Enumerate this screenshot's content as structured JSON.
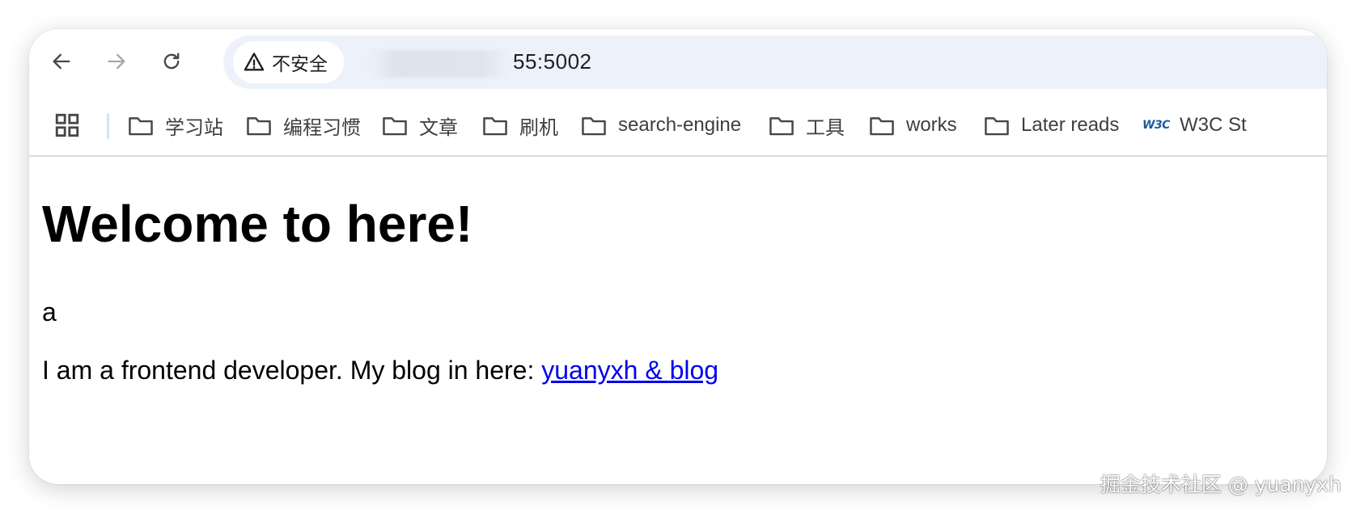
{
  "browser": {
    "nav": {
      "back_icon": "arrow-left-icon",
      "forward_icon": "arrow-right-icon",
      "reload_icon": "reload-icon"
    },
    "omnibox": {
      "security_icon": "warning-triangle-icon",
      "security_label": "不安全",
      "url_visible": "55:5002"
    },
    "bookmarks": [
      {
        "label": "学习站",
        "icon": "folder-icon"
      },
      {
        "label": "编程习惯",
        "icon": "folder-icon"
      },
      {
        "label": "文章",
        "icon": "folder-icon"
      },
      {
        "label": "刷机",
        "icon": "folder-icon"
      },
      {
        "label": "search-engine",
        "icon": "folder-icon"
      },
      {
        "label": "工具",
        "icon": "folder-icon"
      },
      {
        "label": "works",
        "icon": "folder-icon"
      },
      {
        "label": "Later reads",
        "icon": "folder-icon"
      },
      {
        "label": "W3C St",
        "icon": "w3c-logo-icon",
        "logo_text": "W3C"
      }
    ]
  },
  "page": {
    "heading": "Welcome to here!",
    "paragraph_1": "a",
    "paragraph_2_text": "I am a frontend developer. My blog in here: ",
    "blog_link": "yuanyxh & blog"
  },
  "watermark": "掘金技术社区 @ yuanyxh",
  "colors": {
    "omnibox_bg": "#edf2fa",
    "link": "#0000ee",
    "bookmark_text": "#3c4043"
  }
}
